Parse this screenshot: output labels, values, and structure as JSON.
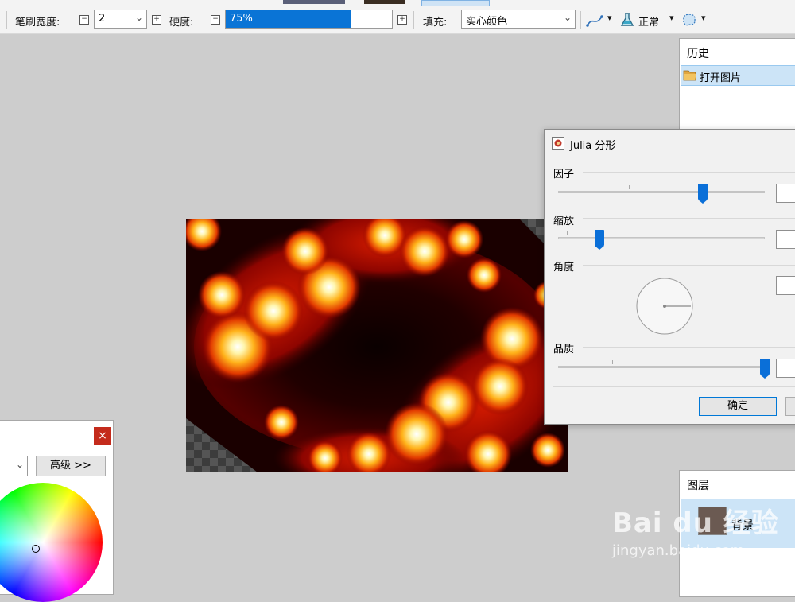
{
  "toolbar": {
    "brush_width_label": "笔刷宽度:",
    "brush_width_value": "2",
    "hardness_label": "硬度:",
    "hardness_value": "75%",
    "hardness_fraction": 0.75,
    "fill_label": "填充:",
    "fill_value": "实心颜色",
    "blend_mode": "正常",
    "minus_glyph": "−",
    "plus_glyph": "+",
    "chevron_glyph": "▾",
    "dropdown_glyph": "⌄"
  },
  "history": {
    "title": "历史",
    "items": [
      {
        "label": "打开图片",
        "selected": true
      }
    ]
  },
  "julia": {
    "title": "Julia 分形",
    "factor_label": "因子",
    "factor_value": 0.7,
    "zoom_label": "缩放",
    "zoom_value": 0.2,
    "angle_label": "角度",
    "angle_value": 0,
    "quality_label": "品质",
    "quality_value": 1.0,
    "ok_label": "确定"
  },
  "layers": {
    "title": "图层",
    "items": [
      {
        "label": "背景",
        "selected": true
      }
    ]
  },
  "color_panel": {
    "close_glyph": "×",
    "advanced_label": "高级 >>"
  },
  "watermark": {
    "brand": "Bai du 经验",
    "url": "jingyan.baidu.com"
  },
  "colors": {
    "accent": "#0a6fd8",
    "selection": "#cce4f7",
    "close_red": "#c42b1c",
    "canvas_bg": "#cdcdcd"
  }
}
